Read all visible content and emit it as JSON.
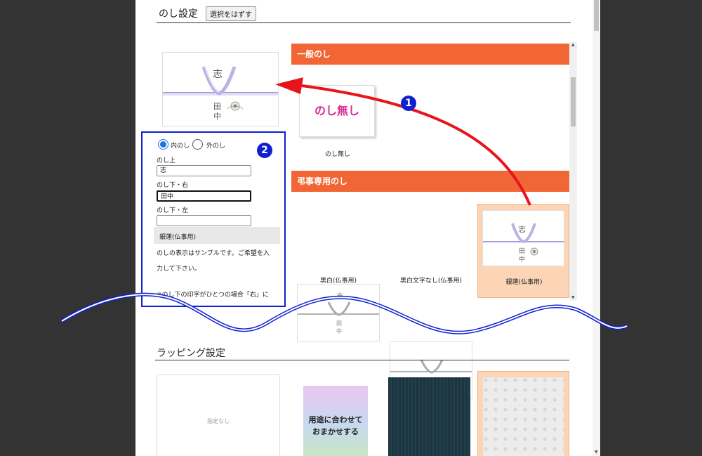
{
  "noshi": {
    "title": "のし設定",
    "deselect_label": "選択をはずす",
    "preview": {
      "top_text": "志",
      "name_right": "田",
      "name_right2": "中"
    },
    "categories": [
      {
        "label": "一般のし",
        "items": [
          {
            "label": "のし無し",
            "thumb_text": "のし無し"
          }
        ]
      },
      {
        "label": "弔事専用のし",
        "items": [
          {
            "label": "黒白(仏事用)",
            "top": "志",
            "name1": "田",
            "name2": "中"
          },
          {
            "label": "黒白文字なし(仏事用)"
          },
          {
            "label": "銀蓮(仏事用)",
            "top": "志",
            "name1": "田",
            "name2": "中",
            "selected": true
          }
        ]
      }
    ],
    "form": {
      "radio_inner": "内のし",
      "radio_outer": "外のし",
      "selected_radio": "内のし",
      "top_label": "のし上",
      "top_value": "志",
      "bottom_right_label": "のし下・右",
      "bottom_right_value": "田中",
      "bottom_left_label": "のし下・左",
      "bottom_left_value": "",
      "selected_name": "銀蓮(仏事用)",
      "note1": "のしの表示はサンプルです。ご希望を入",
      "note2": "力して下さい。",
      "note3": "※のし下の印字がひとつの場合「右」に"
    }
  },
  "wrapping": {
    "title": "ラッピング設定",
    "items": [
      {
        "label": "指定なし"
      },
      {
        "line1": "用途に合わせて",
        "line2": "おまかせする"
      },
      {
        "label": ""
      },
      {
        "label": ""
      }
    ]
  },
  "annotations": {
    "badge1": "1",
    "badge2": "2"
  },
  "colors": {
    "accent_orange": "#f26535",
    "selected_bg": "#fbd5b5",
    "annotation_red": "#e8141c",
    "annotation_blue": "#1020d0"
  }
}
